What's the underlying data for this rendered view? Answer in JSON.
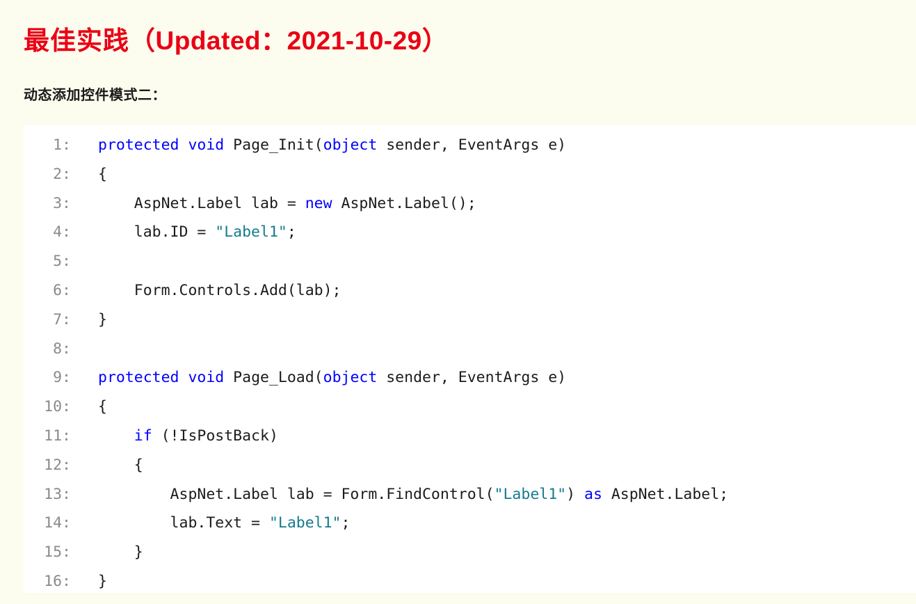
{
  "header": {
    "title_cn": "最佳实践",
    "title_updated": "（Updated：2021-10-29）",
    "subtitle": "动态添加控件模式二：",
    "title_color": "#ea0014",
    "subtitle_color": "#1a1a1a",
    "background_color": "#fdfdef"
  },
  "code_block": {
    "language": "csharp",
    "background_color": "#ffffff",
    "line_number_color": "#8a8a8a",
    "keyword_color": "#0000ff",
    "string_color": "#167b8d",
    "text_color": "#1c1c1c",
    "lines": [
      {
        "number": "1:",
        "tokens": [
          {
            "t": "protected",
            "k": "kw"
          },
          {
            "t": " ",
            "k": "pln"
          },
          {
            "t": "void",
            "k": "kw"
          },
          {
            "t": " Page_Init(",
            "k": "pln"
          },
          {
            "t": "object",
            "k": "kw"
          },
          {
            "t": " sender, EventArgs e)",
            "k": "pln"
          }
        ]
      },
      {
        "number": "2:",
        "tokens": [
          {
            "t": "{",
            "k": "pln"
          }
        ]
      },
      {
        "number": "3:",
        "tokens": [
          {
            "t": "    AspNet.Label lab = ",
            "k": "pln"
          },
          {
            "t": "new",
            "k": "kw"
          },
          {
            "t": " AspNet.Label();",
            "k": "pln"
          }
        ]
      },
      {
        "number": "4:",
        "tokens": [
          {
            "t": "    lab.ID = ",
            "k": "pln"
          },
          {
            "t": "\"Label1\"",
            "k": "str"
          },
          {
            "t": ";",
            "k": "pln"
          }
        ]
      },
      {
        "number": "5:",
        "tokens": [
          {
            "t": "",
            "k": "pln"
          }
        ]
      },
      {
        "number": "6:",
        "tokens": [
          {
            "t": "    Form.Controls.Add(lab);",
            "k": "pln"
          }
        ]
      },
      {
        "number": "7:",
        "tokens": [
          {
            "t": "}",
            "k": "pln"
          }
        ]
      },
      {
        "number": "8:",
        "tokens": [
          {
            "t": "",
            "k": "pln"
          }
        ]
      },
      {
        "number": "9:",
        "tokens": [
          {
            "t": "protected",
            "k": "kw"
          },
          {
            "t": " ",
            "k": "pln"
          },
          {
            "t": "void",
            "k": "kw"
          },
          {
            "t": " Page_Load(",
            "k": "pln"
          },
          {
            "t": "object",
            "k": "kw"
          },
          {
            "t": " sender, EventArgs e)",
            "k": "pln"
          }
        ]
      },
      {
        "number": "10:",
        "tokens": [
          {
            "t": "{",
            "k": "pln"
          }
        ]
      },
      {
        "number": "11:",
        "tokens": [
          {
            "t": "    ",
            "k": "pln"
          },
          {
            "t": "if",
            "k": "kw"
          },
          {
            "t": " (!IsPostBack)",
            "k": "pln"
          }
        ]
      },
      {
        "number": "12:",
        "tokens": [
          {
            "t": "    {",
            "k": "pln"
          }
        ]
      },
      {
        "number": "13:",
        "tokens": [
          {
            "t": "        AspNet.Label lab = Form.FindControl(",
            "k": "pln"
          },
          {
            "t": "\"Label1\"",
            "k": "str"
          },
          {
            "t": ") ",
            "k": "pln"
          },
          {
            "t": "as",
            "k": "kw"
          },
          {
            "t": " AspNet.Label;",
            "k": "pln"
          }
        ]
      },
      {
        "number": "14:",
        "tokens": [
          {
            "t": "        lab.Text = ",
            "k": "pln"
          },
          {
            "t": "\"Label1\"",
            "k": "str"
          },
          {
            "t": ";",
            "k": "pln"
          }
        ]
      },
      {
        "number": "15:",
        "tokens": [
          {
            "t": "    }",
            "k": "pln"
          }
        ]
      },
      {
        "number": "16:",
        "tokens": [
          {
            "t": "}",
            "k": "pln"
          }
        ]
      }
    ]
  }
}
